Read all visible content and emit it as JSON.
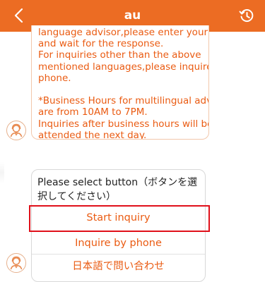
{
  "header": {
    "title": "au",
    "back_icon": "chevron-left-icon",
    "history_icon": "history-icon",
    "color": "#ec6c23"
  },
  "message": {
    "lines": [
      "language advisor,please enter your inquiry",
      "and wait for the response.",
      "For inquiries other than the above",
      "mentioned languages,please inquire by",
      "phone.",
      "",
      "*Business Hours for multilingual advisors",
      "are from 10AM to 7PM.",
      "Inquiries after business hours will be",
      "attended the next day."
    ],
    "text_color": "#ea5b12"
  },
  "menu": {
    "prompt": "Please select button（ボタンを選択してください）",
    "options": [
      {
        "label": "Start inquiry"
      },
      {
        "label": "Inquire by phone"
      },
      {
        "label": "日本語で問い合わせ"
      }
    ],
    "highlight_color": "#e0101a"
  },
  "avatar_icon": "advisor-avatar-icon"
}
